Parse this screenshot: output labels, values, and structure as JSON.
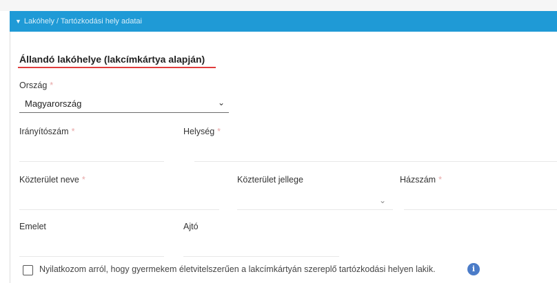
{
  "panel": {
    "header_label": "Lakóhely / Tartózkodási hely adatai"
  },
  "section": {
    "title": "Állandó lakóhelye (lakcímkártya alapján)"
  },
  "form": {
    "country_label": "Ország",
    "country_value": "Magyarország",
    "zip_label": "Irányítószám",
    "city_label": "Helység",
    "street_name_label": "Közterület neve",
    "street_type_label": "Közterület jellege",
    "house_number_label": "Házszám",
    "floor_label": "Emelet",
    "door_label": "Ajtó",
    "required_mark": "*",
    "declaration_text": "Nyilatkozom arról, hogy gyermekem életvitelszerűen a lakcímkártyán szereplő tartózkodási helyen lakik."
  },
  "icons": {
    "chevron_down": "⌄",
    "info": "i"
  },
  "colors": {
    "header_bg": "#1f9ad6",
    "title_underline": "#e03c3c",
    "info_icon": "#4b7cc8"
  }
}
